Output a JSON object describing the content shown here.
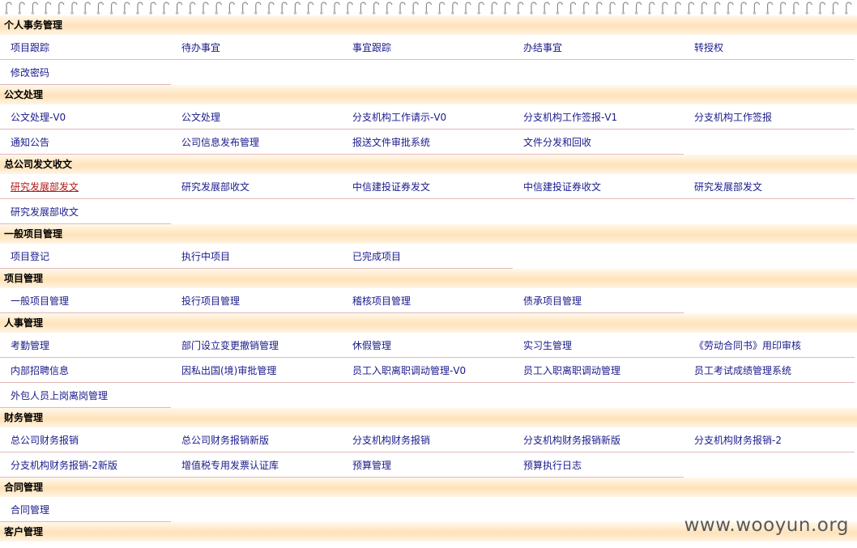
{
  "sections": [
    {
      "title": "个人事务管理",
      "items": [
        "项目跟踪",
        "待办事宜",
        "事宜跟踪",
        "办结事宜",
        "转授权",
        "修改密码"
      ]
    },
    {
      "title": "公文处理",
      "items": [
        "公文处理-V0",
        "公文处理",
        "分支机构工作请示-V0",
        "分支机构工作签报-V1",
        "分支机构工作签报",
        "通知公告",
        "公司信息发布管理",
        "报送文件审批系统",
        "文件分发和回收"
      ]
    },
    {
      "title": "总公司发文收文",
      "items": [
        "研究发展部发文",
        "研究发展部收文",
        "中信建投证券发文",
        "中信建投证券收文",
        "研究发展部发文",
        "研究发展部收文"
      ]
    },
    {
      "title": "一般项目管理",
      "items": [
        "项目登记",
        "执行中项目",
        "已完成项目"
      ]
    },
    {
      "title": "项目管理",
      "items": [
        "一般项目管理",
        "投行项目管理",
        "稽核项目管理",
        "债承项目管理"
      ]
    },
    {
      "title": "人事管理",
      "items": [
        "考勤管理",
        "部门设立变更撤销管理",
        "休假管理",
        "实习生管理",
        "《劳动合同书》用印审核",
        "内部招聘信息",
        "因私出国(境)审批管理",
        "员工入职离职调动管理-V0",
        "员工入职离职调动管理",
        "员工考试成绩管理系统",
        "外包人员上岗离岗管理"
      ]
    },
    {
      "title": "财务管理",
      "items": [
        "总公司财务报销",
        "总公司财务报销新版",
        "分支机构财务报销",
        "分支机构财务报销新版",
        "分支机构财务报销-2",
        "分支机构财务报销-2新版",
        "增值税专用发票认证库",
        "预算管理",
        "预算执行日志"
      ]
    },
    {
      "title": "合同管理",
      "items": [
        "合同管理"
      ]
    },
    {
      "title": "客户管理",
      "items": []
    }
  ],
  "active_item": {
    "section": 2,
    "index": 0
  },
  "watermark": "www.wooyun.org",
  "colors": {
    "link": "#1a1a8c",
    "active_link": "#b01818",
    "header_band": "#ffe2b8"
  }
}
